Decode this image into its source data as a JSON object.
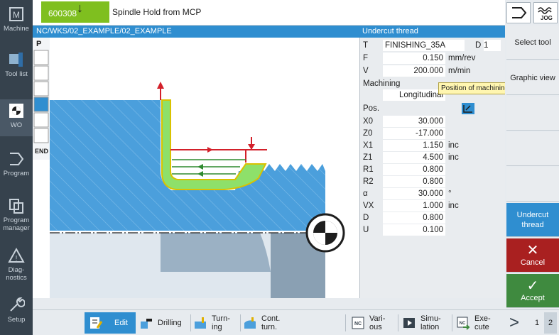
{
  "nav": {
    "items": [
      {
        "label": "Machine"
      },
      {
        "label": "Tool list"
      },
      {
        "label": "WO"
      },
      {
        "label": "Program"
      },
      {
        "label": "Program manager"
      },
      {
        "label": "Diag-nostics"
      },
      {
        "label": "Setup"
      }
    ]
  },
  "top": {
    "program_number": "600308",
    "message": "Spindle Hold from MCP",
    "jog_label": "JOG"
  },
  "path": "NC/WKS/02_EXAMPLE/02_EXAMPLE",
  "cycle_title": "Undercut thread",
  "cycle_icons": [
    "P",
    "END"
  ],
  "params": {
    "T_label": "T",
    "T_value": "FINISHING_35A",
    "D_label": "D",
    "D_value": "1",
    "F_label": "F",
    "F_value": "0.150",
    "F_unit": "mm/rev",
    "V_label": "V",
    "V_value": "200.000",
    "V_unit": "m/min",
    "machining_label": "Machining",
    "machining_value": "Longitudinal",
    "pos_label": "Pos.",
    "tooltip": "Position of machining",
    "rows": [
      {
        "label": "X0",
        "value": "30.000",
        "unit": ""
      },
      {
        "label": "Z0",
        "value": "-17.000",
        "unit": ""
      },
      {
        "label": "X1",
        "value": "1.150",
        "unit": "inc"
      },
      {
        "label": "Z1",
        "value": "4.500",
        "unit": "inc"
      },
      {
        "label": "R1",
        "value": "0.800",
        "unit": ""
      },
      {
        "label": "R2",
        "value": "0.800",
        "unit": ""
      },
      {
        "label": "α",
        "value": "30.000",
        "unit": "°"
      },
      {
        "label": "VX",
        "value": "1.000",
        "unit": "inc"
      },
      {
        "label": "D",
        "value": "0.800",
        "unit": ""
      },
      {
        "label": "U",
        "value": "0.100",
        "unit": ""
      }
    ]
  },
  "softkeys": {
    "select_tool": "Select tool",
    "graphic_view": "Graphic view",
    "undercut_thread": "Undercut thread",
    "cancel": "Cancel",
    "accept": "Accept"
  },
  "bottom": {
    "edit": "Edit",
    "drilling": "Drilling",
    "turning": "Turn-ing",
    "cont_turn": "Cont. turn.",
    "various": "Vari-ous",
    "simulation": "Simu-lation",
    "execute": "Exe-cute",
    "page1": "1",
    "page2": "2"
  },
  "colors": {
    "accent_blue": "#2f8ed0",
    "program_green": "#7fbf1f",
    "cancel_red": "#a92020",
    "accept_green": "#3f8a3f",
    "workpiece_blue": "#4b9fdc",
    "highlight_green": "#8ee06a",
    "path_red": "#d3202a"
  }
}
